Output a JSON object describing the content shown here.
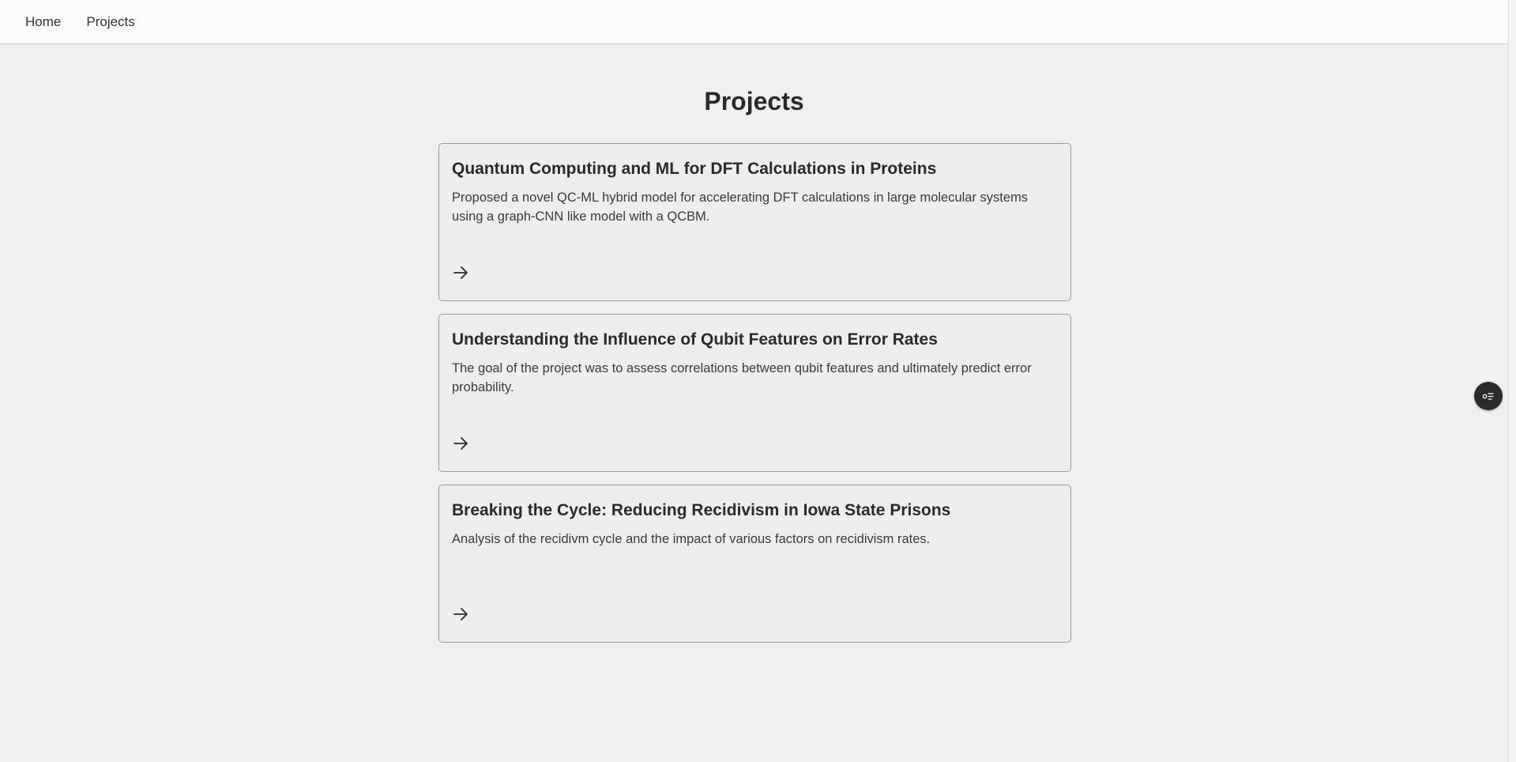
{
  "nav": {
    "items": [
      {
        "label": "Home"
      },
      {
        "label": "Projects"
      }
    ]
  },
  "page": {
    "title": "Projects"
  },
  "projects": [
    {
      "title": "Quantum Computing and ML for DFT Calculations in Proteins",
      "description": "Proposed a novel QC-ML hybrid model for accelerating DFT calculations in large molecular systems using a graph-CNN like model with a QCBM.",
      "arrow_icon": "arrow-right-icon"
    },
    {
      "title": "Understanding the Influence of Qubit Features on Error Rates",
      "description": "The goal of the project was to assess correlations between qubit features and ultimately predict error probability.",
      "arrow_icon": "arrow-right-icon"
    },
    {
      "title": "Breaking the Cycle: Reducing Recidivism in Iowa State Prisons",
      "description": "Analysis of the recidivm cycle and the impact of various factors on recidivism rates.",
      "arrow_icon": "arrow-right-icon"
    }
  ],
  "floating": {
    "toc_icon": "table-of-contents-icon"
  },
  "colors": {
    "background": "#f0f0f0",
    "navbar": "#fbfbfb",
    "card_border": "#9a9a9a",
    "toc_button": "#2b2b2b"
  }
}
